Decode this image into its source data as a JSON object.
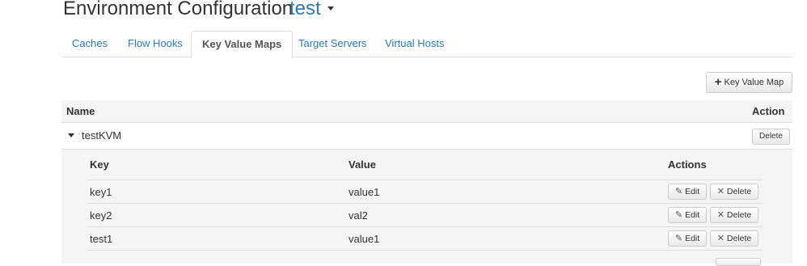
{
  "header": {
    "title": "Environment Configuration",
    "environment": "test"
  },
  "tabs": [
    {
      "label": "Caches",
      "active": false
    },
    {
      "label": "Flow Hooks",
      "active": false
    },
    {
      "label": "Key Value Maps",
      "active": true
    },
    {
      "label": "Target Servers",
      "active": false
    },
    {
      "label": "Virtual Hosts",
      "active": false
    }
  ],
  "toolbar": {
    "add_kvm_label": "Key Value Map",
    "add_icon": "plus-icon"
  },
  "kvm_table": {
    "columns": {
      "name": "Name",
      "action": "Action"
    },
    "rows": [
      {
        "name": "testKVM",
        "expanded": true,
        "delete_label": "Delete"
      }
    ]
  },
  "entries_table": {
    "columns": {
      "key": "Key",
      "value": "Value",
      "actions": "Actions"
    },
    "edit_label": "Edit",
    "delete_label": "Delete",
    "edit_icon": "pencil-icon",
    "delete_icon": "close-icon",
    "rows": [
      {
        "key": "key1",
        "value": "value1"
      },
      {
        "key": "key2",
        "value": "val2"
      },
      {
        "key": "test1",
        "value": "value1"
      }
    ]
  },
  "colors": {
    "link": "#2a7ab9",
    "border": "#dddddd",
    "panel_bg": "#f5f5f5"
  }
}
